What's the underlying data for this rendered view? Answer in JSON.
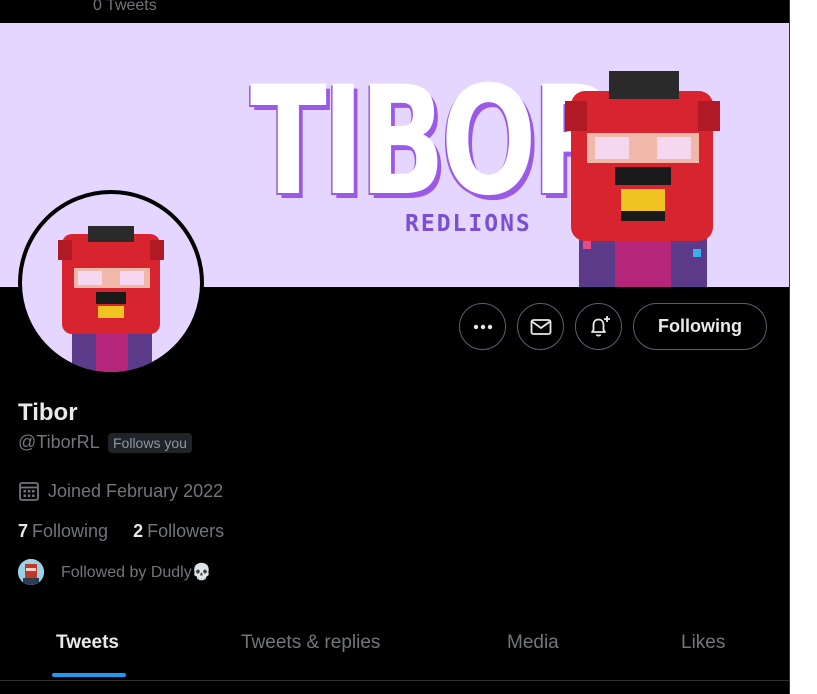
{
  "header": {
    "tweet_count": "0 Tweets"
  },
  "banner": {
    "title": "TIBOR",
    "subtitle": "REDLIONS"
  },
  "actions": {
    "more_icon": "more-horizontal-icon",
    "message_icon": "envelope-icon",
    "notify_icon": "bell-plus-icon",
    "follow_label": "Following"
  },
  "profile": {
    "name": "Tibor",
    "handle": "@TiborRL",
    "follows_you": "Follows you",
    "joined": "Joined February 2022",
    "following_count": "7",
    "following_label": "Following",
    "followers_count": "2",
    "followers_label": "Followers",
    "followed_by": "Followed by Dudly💀"
  },
  "tabs": [
    {
      "label": "Tweets",
      "active": true
    },
    {
      "label": "Tweets & replies",
      "active": false
    },
    {
      "label": "Media",
      "active": false
    },
    {
      "label": "Likes",
      "active": false
    }
  ],
  "colors": {
    "background": "#000000",
    "banner": "#e5d6ff",
    "accent": "#1d9bf0",
    "lion_red": "#d8242f",
    "purple": "#9b59e8"
  }
}
